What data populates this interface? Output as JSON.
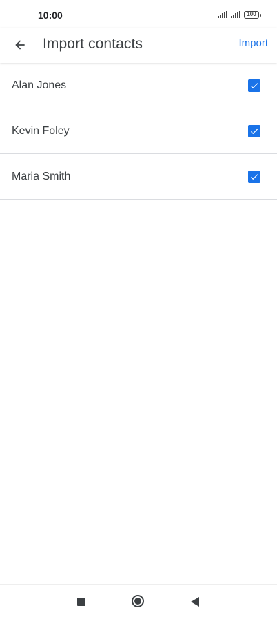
{
  "status_bar": {
    "time": "10:00",
    "battery": "100"
  },
  "app_bar": {
    "title": "Import contacts",
    "action_label": "Import"
  },
  "contacts": [
    {
      "name": "Alan Jones",
      "checked": true
    },
    {
      "name": "Kevin Foley",
      "checked": true
    },
    {
      "name": "Maria Smith",
      "checked": true
    }
  ],
  "colors": {
    "accent": "#1a73e8",
    "text": "#3c4043",
    "divider": "#dadce0"
  },
  "icons": {
    "back": "arrow-left-icon",
    "checkbox": "checkbox-checked-icon",
    "nav_recents": "square-icon",
    "nav_home": "circle-icon",
    "nav_back": "triangle-back-icon"
  }
}
